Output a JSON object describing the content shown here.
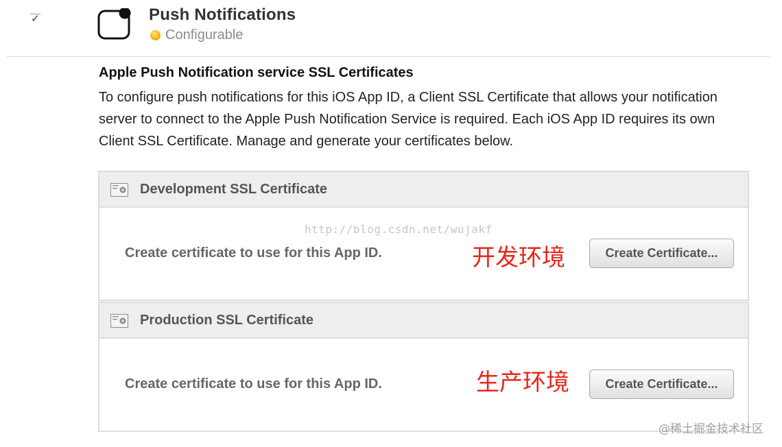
{
  "service": {
    "title": "Push Notifications",
    "status": "Configurable",
    "checkbox_mark": "✓",
    "icon": "notification-app-icon",
    "status_color": "#f3b51c"
  },
  "section": {
    "heading": "Apple Push Notification service SSL Certificates",
    "description": "To configure push notifications for this iOS App ID, a Client SSL Certificate that allows your notification server to connect to the Apple Push Notification Service is required. Each iOS App ID requires its own Client SSL Certificate. Manage and generate your certificates below."
  },
  "certificates": [
    {
      "title": "Development SSL Certificate",
      "text": "Create certificate to use for this App ID.",
      "env_label": "开发环境",
      "button_label": "Create Certificate...",
      "icon": "certificate-icon"
    },
    {
      "title": "Production SSL Certificate",
      "text": "Create certificate to use for this App ID.",
      "env_label": "生产环境",
      "button_label": "Create Certificate...",
      "icon": "certificate-icon"
    }
  ],
  "watermark": "http://blog.csdn.net/wujakf",
  "credit": "@稀土掘金技术社区",
  "colors": {
    "annotation_red": "#e8261a",
    "panel_header_bg": "#eeeeee"
  }
}
